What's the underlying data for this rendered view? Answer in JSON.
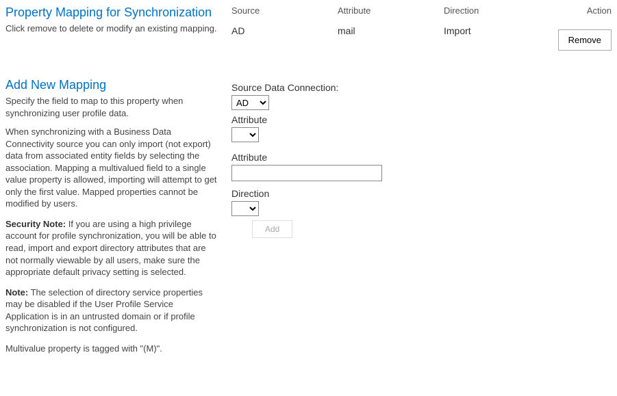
{
  "section1": {
    "title": "Property Mapping for Synchronization",
    "desc": "Click remove to delete or modify an existing mapping.",
    "headers": {
      "source": "Source",
      "attribute": "Attribute",
      "direction": "Direction",
      "action": "Action"
    },
    "row": {
      "source": "AD",
      "attribute": "mail",
      "direction": "Import"
    },
    "remove_label": "Remove"
  },
  "section2": {
    "title": "Add New Mapping",
    "desc": "Specify the field to map to this property when synchronizing user profile data.",
    "para1": "When synchronizing with a Business Data Connectivity source you can only import (not export) data from associated entity fields by selecting  the association. Mapping a multivalued field to a single value property is allowed, importing will attempt to get only the first value. Mapped properties cannot be modified by users.",
    "security_label": "Security Note:",
    "security_text": " If you are using a high privilege account for profile synchronization, you will be able to read, import and export directory attributes that are not normally viewable by all users, make sure the appropriate default privacy setting is selected.",
    "note_label": "Note:",
    "note_text": " The selection of directory service properties may be disabled if the User Profile Service Application is in an untrusted domain or if profile synchronization is not configured.",
    "multivalue": "Multivalue property is tagged with \"(M)\".",
    "form": {
      "source_label": "Source Data Connection:",
      "source_value": "AD",
      "attribute1_label": "Attribute",
      "attribute2_label": "Attribute",
      "attribute_text_value": "",
      "direction_label": "Direction",
      "add_label": "Add"
    }
  }
}
